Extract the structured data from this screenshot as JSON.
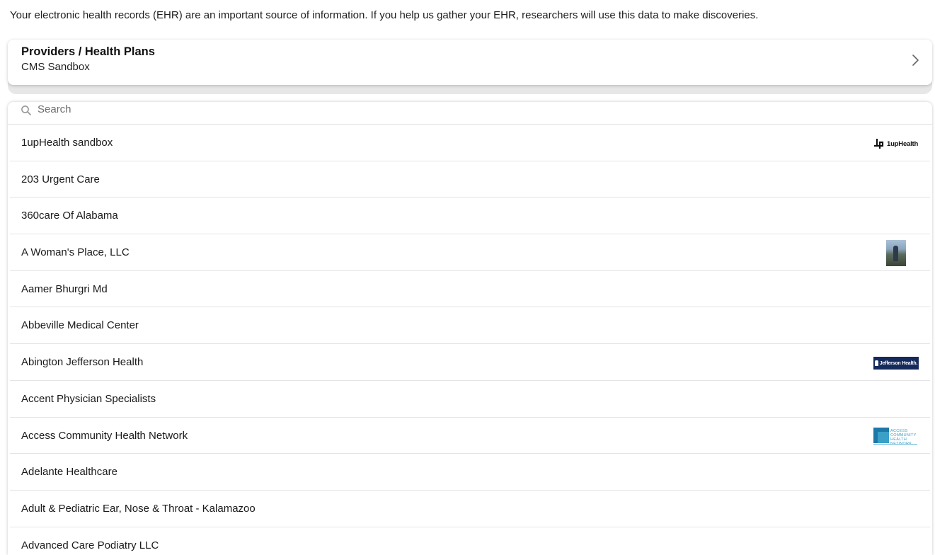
{
  "intro_text": "Your electronic health records (EHR) are an important source of information. If you help us gather your EHR, researchers will use this data to make discoveries.",
  "provider_card": {
    "title": "Providers / Health Plans",
    "subtitle": "CMS Sandbox",
    "icon": "chevron-right-icon"
  },
  "search": {
    "placeholder": "Search",
    "value": "",
    "icon": "search-icon"
  },
  "providers": [
    {
      "name": "1upHealth sandbox",
      "logo": "1upHealth",
      "logo_text": "1upHealth"
    },
    {
      "name": "203 Urgent Care",
      "logo": ""
    },
    {
      "name": "360care Of Alabama",
      "logo": ""
    },
    {
      "name": "A Woman's Place, LLC",
      "logo": "photo"
    },
    {
      "name": "Aamer Bhurgri Md",
      "logo": ""
    },
    {
      "name": "Abbeville Medical Center",
      "logo": ""
    },
    {
      "name": "Abington Jefferson Health",
      "logo": "jefferson",
      "logo_text": "Jefferson Health."
    },
    {
      "name": "Accent Physician Specialists",
      "logo": ""
    },
    {
      "name": "Access Community Health Network",
      "logo": "achn",
      "logo_text": "ACCESS COMMUNITY HEALTH NETWORK"
    },
    {
      "name": "Adelante Healthcare",
      "logo": ""
    },
    {
      "name": "Adult & Pediatric Ear, Nose & Throat - Kalamazoo",
      "logo": ""
    },
    {
      "name": "Advanced Care Podiatry LLC",
      "logo": ""
    }
  ],
  "colors": {
    "jefferson_navy": "#152a5c",
    "access_blue": "#1d78a8",
    "divider": "#e4e4e4"
  }
}
